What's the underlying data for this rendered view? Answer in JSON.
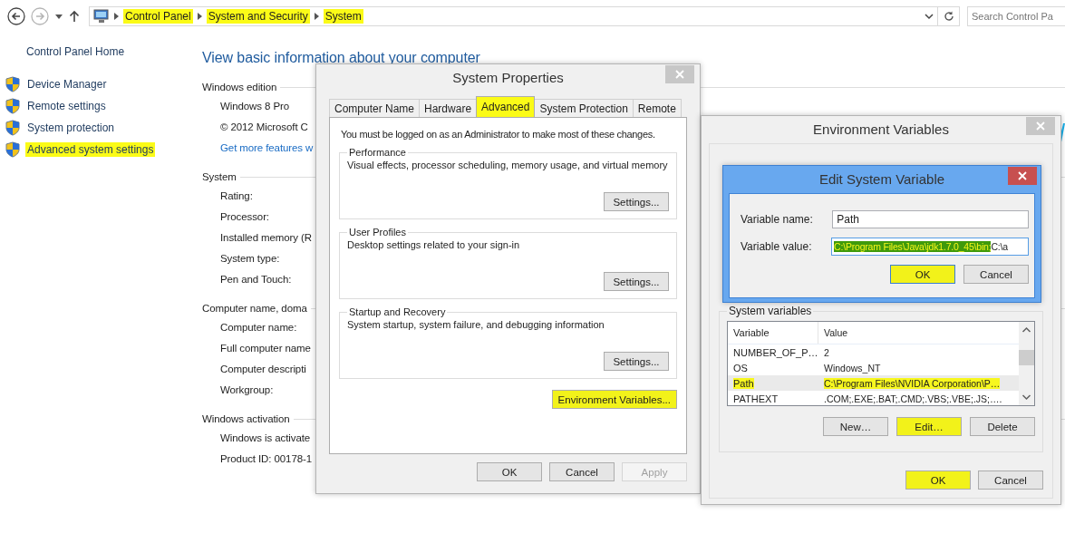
{
  "address_bar": {
    "breadcrumbs": [
      {
        "label": "Control Panel",
        "highlighted": true
      },
      {
        "label": "System and Security",
        "highlighted": true
      },
      {
        "label": "System",
        "highlighted": true
      }
    ],
    "search": {
      "placeholder": "Search Control Pa"
    }
  },
  "sidebar": {
    "home_link": "Control Panel Home",
    "items": [
      {
        "label": "Device Manager",
        "highlighted": false
      },
      {
        "label": "Remote settings",
        "highlighted": false
      },
      {
        "label": "System protection",
        "highlighted": false
      },
      {
        "label": "Advanced system settings",
        "highlighted": true
      }
    ]
  },
  "main": {
    "heading": "View basic information about your computer",
    "sections": [
      {
        "title": "Windows edition",
        "rows": [
          {
            "kind": "text",
            "text": "Windows 8 Pro"
          },
          {
            "kind": "text",
            "text": "© 2012 Microsoft C"
          },
          {
            "kind": "link",
            "text": "Get more features w"
          }
        ]
      },
      {
        "title": "System",
        "rows": [
          {
            "kind": "text",
            "text": "Rating:"
          },
          {
            "kind": "text",
            "text": "Processor:"
          },
          {
            "kind": "text",
            "text": "Installed memory (R"
          },
          {
            "kind": "text",
            "text": "System type:"
          },
          {
            "kind": "text",
            "text": "Pen and Touch:"
          }
        ]
      },
      {
        "title": "Computer name, doma",
        "rows": [
          {
            "kind": "text",
            "text": "Computer name:"
          },
          {
            "kind": "text",
            "text": "Full computer name"
          },
          {
            "kind": "text",
            "text": "Computer descripti"
          },
          {
            "kind": "text",
            "text": "Workgroup:"
          }
        ]
      },
      {
        "title": "Windows activation",
        "rows": [
          {
            "kind": "text",
            "text": "Windows is activate"
          },
          {
            "kind": "text",
            "text": "Product ID:  00178-1"
          }
        ]
      }
    ]
  },
  "system_properties": {
    "title": "System Properties",
    "tabs": [
      {
        "label": "Computer Name",
        "selected": false,
        "highlighted": false
      },
      {
        "label": "Hardware",
        "selected": false,
        "highlighted": false
      },
      {
        "label": "Advanced",
        "selected": true,
        "highlighted": true
      },
      {
        "label": "System Protection",
        "selected": false,
        "highlighted": false
      },
      {
        "label": "Remote",
        "selected": false,
        "highlighted": false
      }
    ],
    "notice": "You must be logged on as an Administrator to make most of these changes.",
    "groups": [
      {
        "title": "Performance",
        "description": "Visual effects, processor scheduling, memory usage, and virtual memory",
        "button": "Settings..."
      },
      {
        "title": "User Profiles",
        "description": "Desktop settings related to your sign-in",
        "button": "Settings..."
      },
      {
        "title": "Startup and Recovery",
        "description": "System startup, system failure, and debugging information",
        "button": "Settings..."
      }
    ],
    "env_button": {
      "label": "Environment Variables...",
      "highlighted": true
    },
    "buttons": [
      {
        "label": "OK",
        "disabled": false
      },
      {
        "label": "Cancel",
        "disabled": false
      },
      {
        "label": "Apply",
        "disabled": true
      }
    ]
  },
  "environment_variables": {
    "title": "Environment Variables",
    "system_variables": {
      "title": "System variables",
      "columns": [
        "Variable",
        "Value"
      ],
      "rows": [
        {
          "variable": "NUMBER_OF_P…",
          "value": "2",
          "selected": false,
          "highlighted": false
        },
        {
          "variable": "OS",
          "value": "Windows_NT",
          "selected": false,
          "highlighted": false
        },
        {
          "variable": "Path",
          "value": "C:\\Program Files\\NVIDIA Corporation\\P…",
          "selected": true,
          "highlighted": true
        },
        {
          "variable": "PATHEXT",
          "value": ".COM;.EXE;.BAT;.CMD;.VBS;.VBE;.JS;….",
          "selected": false,
          "highlighted": false
        }
      ]
    },
    "buttons": [
      {
        "label": "New…",
        "highlighted": false
      },
      {
        "label": "Edit…",
        "highlighted": true
      },
      {
        "label": "Delete",
        "highlighted": false
      }
    ],
    "footer_buttons": [
      {
        "label": "OK",
        "highlighted": true
      },
      {
        "label": "Cancel",
        "highlighted": false
      }
    ]
  },
  "edit_system_variable": {
    "title": "Edit System Variable",
    "name_field": {
      "label": "Variable name:",
      "value": "Path"
    },
    "value_field": {
      "label": "Variable value:",
      "selected_text": "C:\\Program Files\\Java\\jdk1.7.0_45\\bin;",
      "rest_text": "C:\\a"
    },
    "buttons": [
      {
        "label": "OK",
        "highlighted": true
      },
      {
        "label": "Cancel",
        "highlighted": false
      }
    ]
  }
}
